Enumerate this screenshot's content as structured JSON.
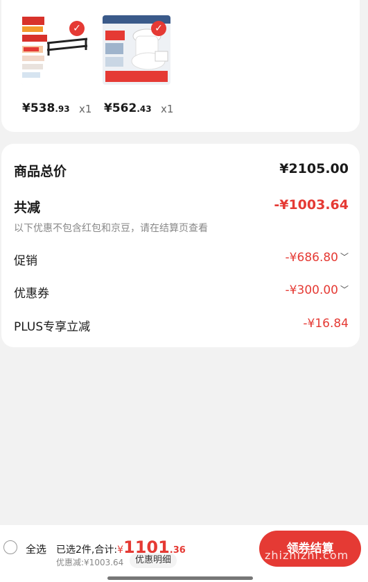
{
  "products": [
    {
      "price_int": "¥538",
      "price_dec": ".93",
      "qty": "x1",
      "selected": true
    },
    {
      "price_int": "¥562",
      "price_dec": ".43",
      "qty": "x1",
      "selected": true
    }
  ],
  "summary": {
    "total_label": "商品总价",
    "total_value": "¥2105.00",
    "reduce_label": "共减",
    "reduce_value": "-¥1003.64",
    "note": "以下优惠不包含红包和京豆，请在结算页查看",
    "promo_label": "促销",
    "promo_value": "-¥686.80",
    "coupon_label": "优惠券",
    "coupon_value": "-¥300.00",
    "plus_label": "PLUS专享立减",
    "plus_value": "-¥16.84"
  },
  "bottom": {
    "select_all": "全选",
    "selected_text": "已选2件,合计:",
    "currency": "¥",
    "total_int": "1101",
    "total_dec": ".36",
    "discount_text": "优惠减:¥1003.64",
    "detail_button": "优惠明细",
    "checkout_button": "领券结算",
    "watermark": "zhizhizhi.com"
  },
  "colors": {
    "accent": "#e53a34",
    "background": "#f2f2f2"
  }
}
